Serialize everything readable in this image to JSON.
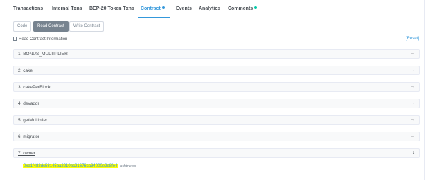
{
  "tabs": [
    {
      "label": "Transactions"
    },
    {
      "label": "Internal Txns"
    },
    {
      "label": "BEP-20 Token Txns"
    },
    {
      "label": "Contract"
    },
    {
      "label": "Events"
    },
    {
      "label": "Analytics"
    },
    {
      "label": "Comments"
    }
  ],
  "subtabs": {
    "code": "Code",
    "read": "Read Contract",
    "write": "Write Contract"
  },
  "info": {
    "title": "Read Contract Information",
    "reset": "[Reset]"
  },
  "rows": [
    {
      "label": "1. BONUS_MULTIPLIER"
    },
    {
      "label": "2. cake"
    },
    {
      "label": "3. cakePerBlock"
    },
    {
      "label": "4. devaddr"
    },
    {
      "label": "5. getMultiplier"
    },
    {
      "label": "6. migrator"
    },
    {
      "label": "7. owner"
    }
  ],
  "owner_result": {
    "address": "0xa1f482dc58145ba2210bc21676ca34000e2e8fe4",
    "type": "address"
  },
  "colors": {
    "accent": "#3498db",
    "highlight": "#ffff00",
    "comments_dot": "#00c9a7"
  }
}
